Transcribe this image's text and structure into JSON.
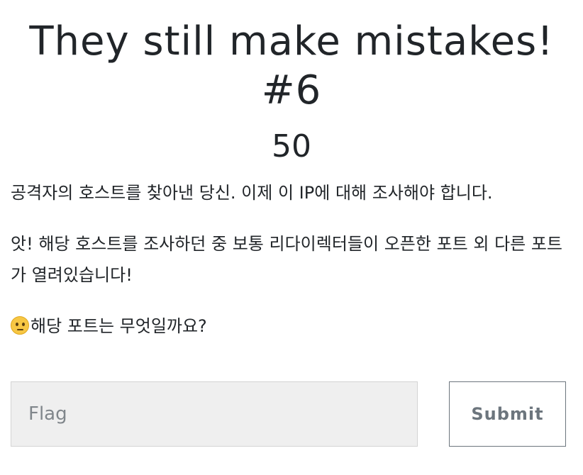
{
  "challenge": {
    "title": "They still make mistakes! #6",
    "value": "50",
    "description": [
      "공격자의 호스트를 찾아낸 당신. 이제 이 IP에 대해 조사해야 합니다.",
      "앗! 해당 호스트를 조사하던 중 보통 리다이렉터들이 오픈한 포트 외 다른 포트가 열려있습니다!",
      "해당 포트는 무엇일까요?"
    ],
    "emoji_icon": "thinking-face-icon"
  },
  "form": {
    "flag_placeholder": "Flag",
    "flag_value": "",
    "submit_label": "Submit"
  },
  "colors": {
    "text": "#212529",
    "input_bg": "#efefef",
    "button_border": "#6c757d"
  }
}
